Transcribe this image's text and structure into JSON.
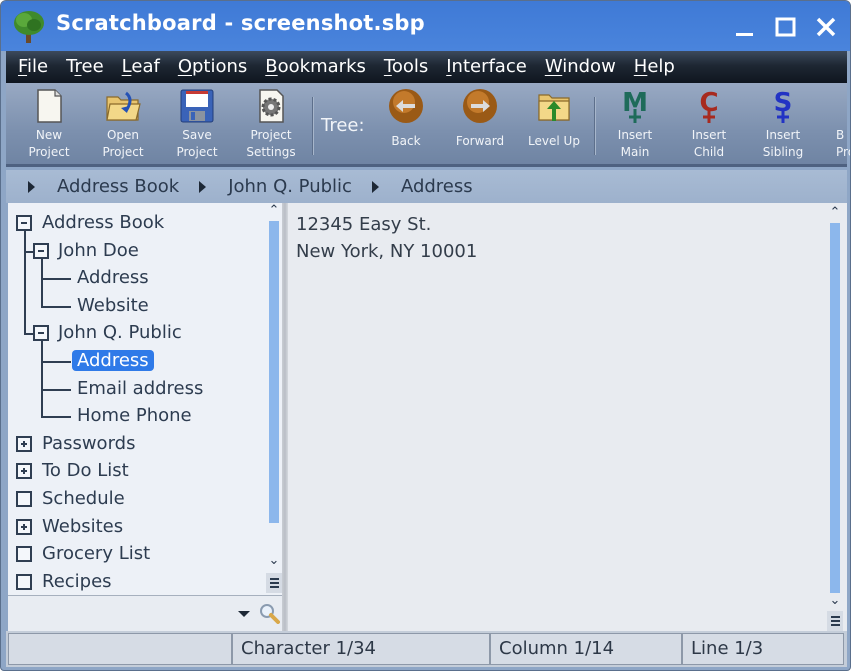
{
  "window": {
    "title": "Scratchboard - screenshot.sbp",
    "icon": "tree-icon",
    "controls": {
      "minimize": "minimize-icon",
      "maximize": "maximize-icon",
      "close": "close-icon"
    }
  },
  "menu": [
    {
      "label": "File",
      "mnemonic": "F"
    },
    {
      "label": "Tree",
      "mnemonic": "r"
    },
    {
      "label": "Leaf",
      "mnemonic": "L"
    },
    {
      "label": "Options",
      "mnemonic": "O"
    },
    {
      "label": "Bookmarks",
      "mnemonic": "B"
    },
    {
      "label": "Tools",
      "mnemonic": "T"
    },
    {
      "label": "Interface",
      "mnemonic": "I"
    },
    {
      "label": "Window",
      "mnemonic": "W"
    },
    {
      "label": "Help",
      "mnemonic": "H"
    }
  ],
  "toolbar": {
    "tree_label": "Tree:",
    "buttons": [
      {
        "id": "new-project",
        "line1": "New",
        "line2": "Project",
        "icon": "new-document-icon"
      },
      {
        "id": "open-project",
        "line1": "Open",
        "line2": "Project",
        "icon": "open-folder-icon"
      },
      {
        "id": "save-project",
        "line1": "Save",
        "line2": "Project",
        "icon": "floppy-disk-icon"
      },
      {
        "id": "project-settings",
        "line1": "Project",
        "line2": "Settings",
        "icon": "settings-gear-icon"
      },
      {
        "id": "back",
        "line1": "Back",
        "line2": "",
        "icon": "back-arrow-icon"
      },
      {
        "id": "forward",
        "line1": "Forward",
        "line2": "",
        "icon": "forward-arrow-icon"
      },
      {
        "id": "level-up",
        "line1": "Level Up",
        "line2": "",
        "icon": "level-up-folder-icon"
      },
      {
        "id": "insert-main",
        "line1": "Insert",
        "line2": "Main",
        "icon": "insert-main-icon"
      },
      {
        "id": "insert-child",
        "line1": "Insert",
        "line2": "Child",
        "icon": "insert-child-icon"
      },
      {
        "id": "insert-sibling",
        "line1": "Insert",
        "line2": "Sibling",
        "icon": "insert-sibling-icon"
      },
      {
        "id": "b-project",
        "line1": "B",
        "line2": "Pro",
        "icon": "partial-icon"
      }
    ]
  },
  "breadcrumb": [
    "Address Book",
    "John Q. Public",
    "Address"
  ],
  "tree": {
    "items": [
      {
        "label": "Address Book",
        "level": 0,
        "state": "expanded"
      },
      {
        "label": "John Doe",
        "level": 1,
        "state": "expanded"
      },
      {
        "label": "Address",
        "level": 2,
        "state": "leaf"
      },
      {
        "label": "Website",
        "level": 2,
        "state": "leaf"
      },
      {
        "label": "John Q. Public",
        "level": 1,
        "state": "expanded"
      },
      {
        "label": "Address",
        "level": 2,
        "state": "leaf",
        "selected": true
      },
      {
        "label": "Email address",
        "level": 2,
        "state": "leaf"
      },
      {
        "label": "Home Phone",
        "level": 2,
        "state": "leaf"
      },
      {
        "label": "Passwords",
        "level": 0,
        "state": "collapsed"
      },
      {
        "label": "To Do List",
        "level": 0,
        "state": "collapsed"
      },
      {
        "label": "Schedule",
        "level": 0,
        "state": "empty"
      },
      {
        "label": "Websites",
        "level": 0,
        "state": "collapsed"
      },
      {
        "label": "Grocery List",
        "level": 0,
        "state": "empty"
      },
      {
        "label": "Recipes",
        "level": 0,
        "state": "empty"
      }
    ],
    "search_value": ""
  },
  "editor": {
    "text": "12345 Easy St.\nNew York, NY 10001"
  },
  "status": {
    "cell1": "",
    "character": "Character 1/34",
    "column": "Column 1/14",
    "line": "Line 1/3"
  },
  "colors": {
    "titlebar": "#4a84dc",
    "selection": "#2f7ae8",
    "scroll_thumb": "#8cb7ec"
  }
}
